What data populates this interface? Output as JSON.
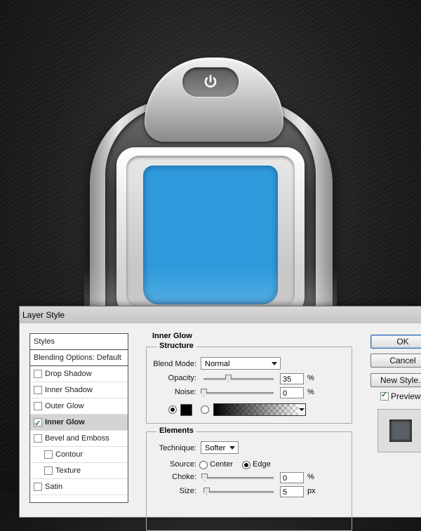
{
  "dialog": {
    "title": "Layer Style",
    "styles_list": {
      "header": "Styles",
      "blending": "Blending Options: Default",
      "items": [
        {
          "label": "Drop Shadow",
          "checked": false,
          "sub": false,
          "active": false
        },
        {
          "label": "Inner Shadow",
          "checked": false,
          "sub": false,
          "active": false
        },
        {
          "label": "Outer Glow",
          "checked": false,
          "sub": false,
          "active": false
        },
        {
          "label": "Inner Glow",
          "checked": true,
          "sub": false,
          "active": true
        },
        {
          "label": "Bevel and Emboss",
          "checked": false,
          "sub": false,
          "active": false
        },
        {
          "label": "Contour",
          "checked": false,
          "sub": true,
          "active": false
        },
        {
          "label": "Texture",
          "checked": false,
          "sub": true,
          "active": false
        },
        {
          "label": "Satin",
          "checked": false,
          "sub": false,
          "active": false
        }
      ]
    },
    "inner_glow": {
      "title": "Inner Glow",
      "structure": {
        "title": "Structure",
        "blend_mode_label": "Blend Mode:",
        "blend_mode_value": "Normal",
        "opacity_label": "Opacity:",
        "opacity_value": "35",
        "opacity_fraction": 0.35,
        "opacity_unit": "%",
        "noise_label": "Noise:",
        "noise_value": "0",
        "noise_fraction": 0,
        "noise_unit": "%",
        "color_swatch": "#000000"
      },
      "elements": {
        "title": "Elements",
        "technique_label": "Technique:",
        "technique_value": "Softer",
        "source_label": "Source:",
        "source_center": "Center",
        "source_edge": "Edge",
        "source_selected": "Edge",
        "choke_label": "Choke:",
        "choke_value": "0",
        "choke_unit": "%",
        "size_label": "Size:",
        "size_value": "5",
        "size_unit": "px"
      }
    },
    "buttons": {
      "ok": "OK",
      "cancel": "Cancel",
      "new_style": "New Style...",
      "preview_label": "Preview",
      "preview_checked": true
    }
  },
  "device": {
    "screen_color": "#2f9bdc",
    "power_icon": "power-icon"
  }
}
